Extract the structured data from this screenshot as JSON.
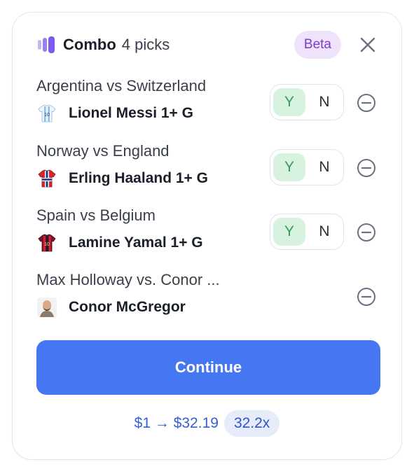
{
  "header": {
    "title": "Combo",
    "subtitle": "4 picks",
    "badge": "Beta"
  },
  "picks": [
    {
      "match": "Argentina vs Switzerland",
      "player": "Lionel Messi 1+ G",
      "yes": "Y",
      "no": "N",
      "avatar": "argentina-jersey-icon"
    },
    {
      "match": "Norway vs England",
      "player": "Erling Haaland 1+ G",
      "yes": "Y",
      "no": "N",
      "avatar": "norway-jersey-icon"
    },
    {
      "match": "Spain vs Belgium",
      "player": "Lamine Yamal 1+ G",
      "yes": "Y",
      "no": "N",
      "avatar": "barcelona-jersey-icon"
    },
    {
      "match": "Max Holloway vs. Conor ...",
      "player": "Conor McGregor",
      "avatar": "fighter-portrait-icon"
    }
  ],
  "continue_label": "Continue",
  "payout": {
    "text": "$1 → $32.19",
    "multiplier": "32.2x"
  },
  "colors": {
    "accent": "#4677f3",
    "yes_bg": "#d7f3df",
    "beta_bg": "#efe2fb"
  }
}
